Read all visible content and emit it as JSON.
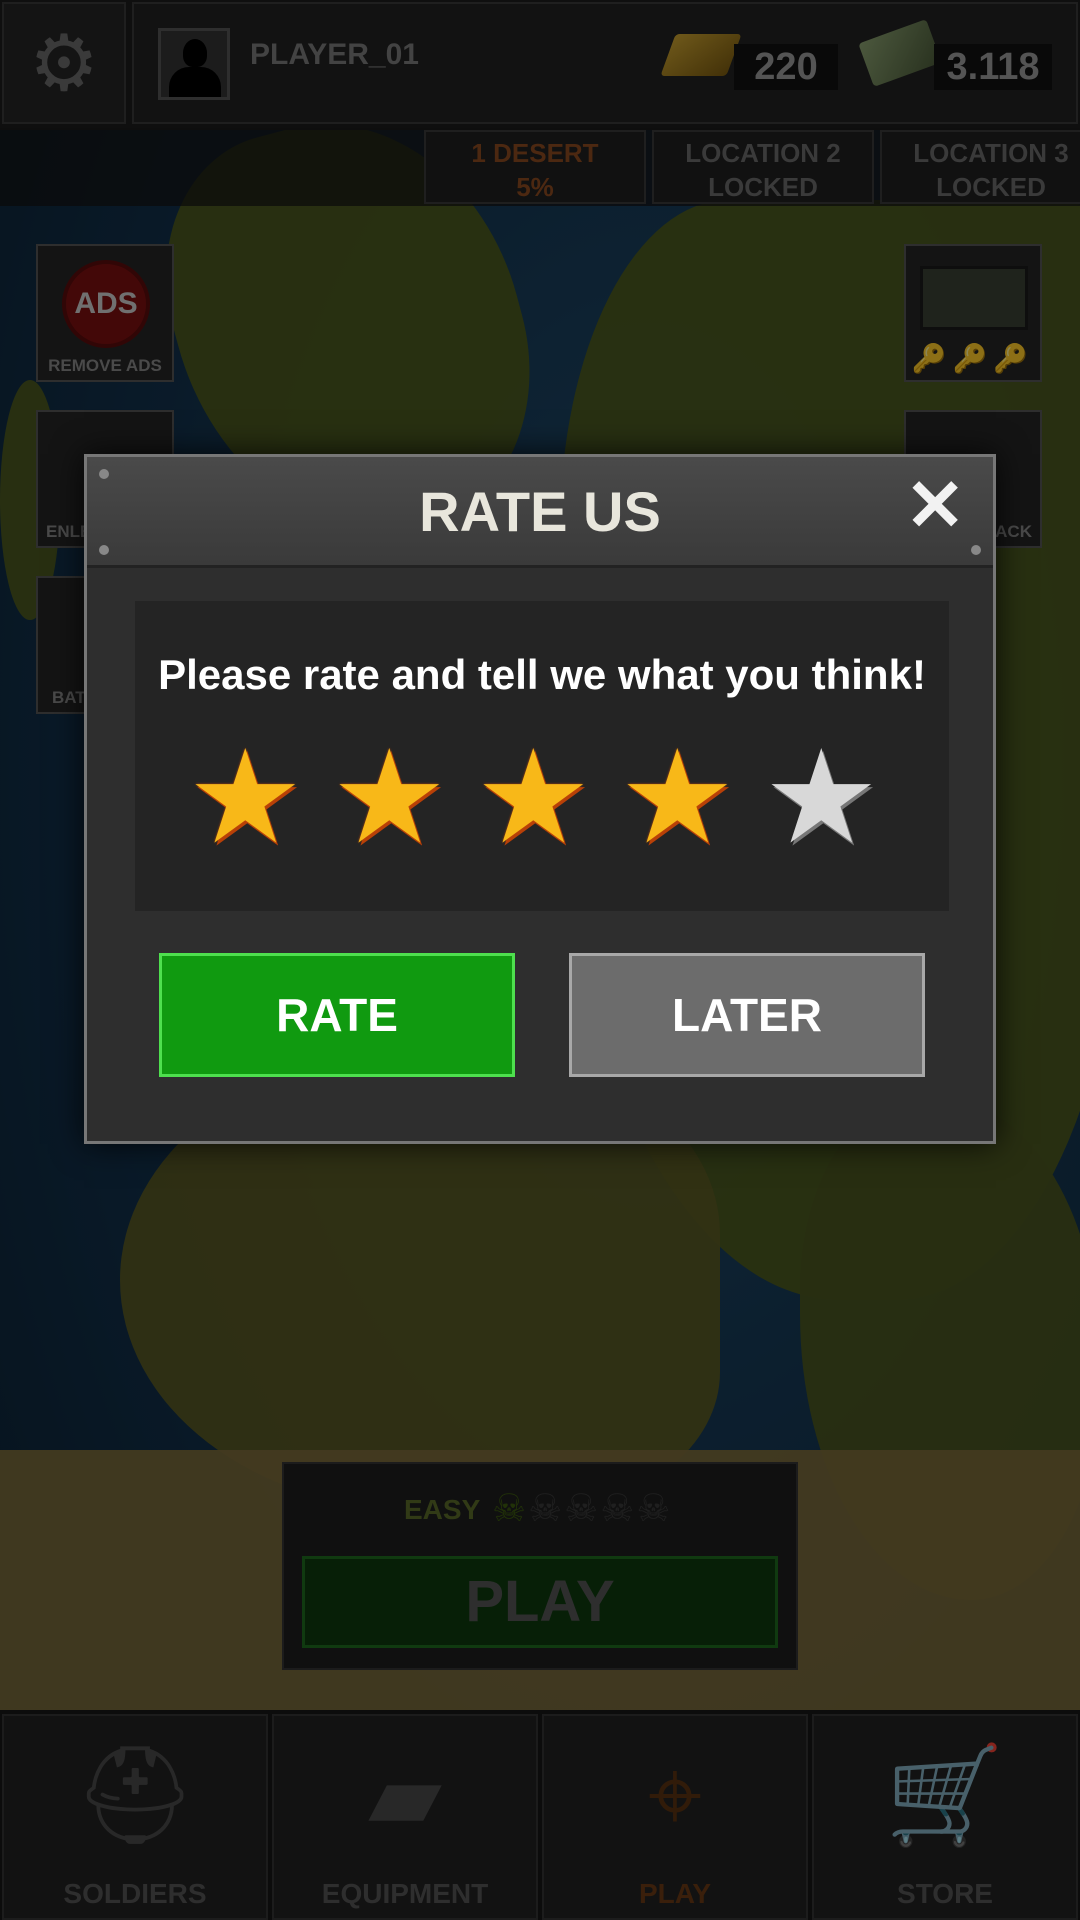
{
  "header": {
    "player_name": "PLAYER_01",
    "gold": "220",
    "cash": "3.118"
  },
  "locations": [
    {
      "line1": "1 DESERT",
      "line2": "5%",
      "state": "active"
    },
    {
      "line1": "LOCATION 2",
      "line2": "LOCKED",
      "state": "locked"
    },
    {
      "line1": "LOCATION 3",
      "line2": "LOCKED",
      "state": "locked"
    }
  ],
  "side_buttons": {
    "remove_ads": "REMOVE ADS",
    "ads_badge": "ADS",
    "enlist_partial": "ENLE",
    "battle_partial": "BAT",
    "pack_partial": "PACK"
  },
  "dialog": {
    "title": "RATE US",
    "close": "✕",
    "message": "Please rate and tell we what you think!",
    "rating": 4,
    "max_rating": 5,
    "rate_label": "RATE",
    "later_label": "LATER"
  },
  "play_panel": {
    "difficulty": "EASY",
    "difficulty_level": 1,
    "difficulty_max": 5,
    "play_label": "PLAY"
  },
  "nav": {
    "tabs": [
      {
        "label": "SOLDIERS",
        "icon": "helmet-icon"
      },
      {
        "label": "EQUIPMENT",
        "icon": "pistol-icon"
      },
      {
        "label": "PLAY",
        "icon": "crosshair-icon",
        "active": true
      },
      {
        "label": "STORE",
        "icon": "cart-icon"
      }
    ]
  },
  "colors": {
    "rate_button": "#109a10",
    "later_button": "#6c6c6c",
    "star_on": "#f8b818",
    "star_off": "#d8d8d8",
    "active_tab": "#6a3a14"
  }
}
